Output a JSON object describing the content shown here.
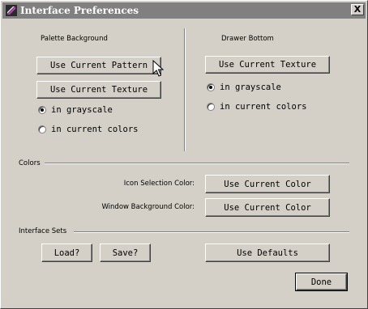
{
  "window": {
    "title": "Interface Preferences",
    "close_glyph": "X",
    "app_icon": "app-icon"
  },
  "palette": {
    "heading": "Palette Background",
    "use_pattern": "Use Current Pattern",
    "use_texture": "Use Current Texture",
    "options": [
      {
        "label": "in grayscale",
        "checked": true
      },
      {
        "label": "in current colors",
        "checked": false
      }
    ]
  },
  "drawer": {
    "heading": "Drawer Bottom",
    "use_texture": "Use Current Texture",
    "options": [
      {
        "label": "in grayscale",
        "checked": true
      },
      {
        "label": "in current colors",
        "checked": false
      }
    ]
  },
  "colors": {
    "section": "Colors",
    "icon_selection_label": "Icon Selection Color:",
    "icon_selection_button": "Use Current Color",
    "window_bg_label": "Window Background Color:",
    "window_bg_button": "Use Current Color"
  },
  "sets": {
    "section": "Interface Sets",
    "load": "Load?",
    "save": "Save?",
    "defaults": "Use Defaults"
  },
  "done": "Done",
  "theme": {
    "face": "#d4d0c8",
    "title_bar": "#808080",
    "title_text": "#ffffff"
  }
}
